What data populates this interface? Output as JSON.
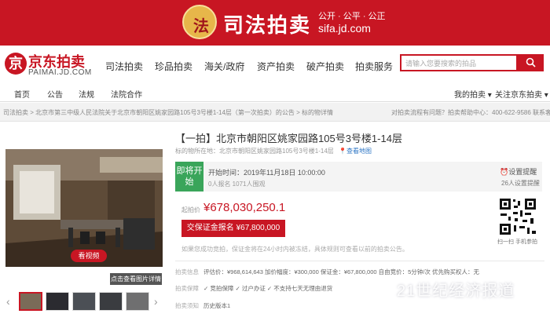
{
  "banner": {
    "emblem_text": "法",
    "title": "司法拍卖",
    "slogan": "公开 · 公平 · 公正",
    "domain": "sifa.jd.com"
  },
  "header": {
    "logo_mark": "京",
    "logo_cn": "京东拍卖",
    "logo_en": "PAIMAI.JD.COM",
    "nav": [
      "司法拍卖",
      "珍品拍卖",
      "海关/政府",
      "资产拍卖",
      "破产拍卖",
      "拍卖服务"
    ],
    "search_placeholder": "请输入您要搜索的拍品"
  },
  "subnav": {
    "items": [
      "首页",
      "公告",
      "法规",
      "法院合作"
    ],
    "right": [
      "我的拍卖 ▾",
      "关注京东拍卖 ▾"
    ]
  },
  "breadcrumb": {
    "path": "司法拍卖 > 北京市第三中级人民法院关于北京市朝阳区姚家园路105号3号楼1-14层（第一次拍卖）的公告 > 标的物详情",
    "right": "对拍卖流程有问题？拍卖帮助中心：400-622-9586  联系客服"
  },
  "gallery": {
    "video_label": "看视频",
    "more_label": "点击查看图片详情",
    "prev": "‹",
    "next": "›"
  },
  "item": {
    "title": "【一拍】北京市朝阳区姚家园路105号3号楼1-14层",
    "address_label": "标的物所在地：",
    "address": "北京市朝阳区姚家园路105号3号楼1-14层",
    "map_link": "查看地图",
    "status": "即将开始",
    "start_time": "开始时间：2019年11月18日 10:00:00",
    "watchers": "0人报名  1071人围观",
    "remind_label": "设置提醒",
    "remind_count": "26人设置提醒",
    "price_label": "起拍价",
    "price": "¥678,030,250.1",
    "deposit_button": "交保证金报名 ¥67,800,000",
    "notice": "如果您成功竞拍，保证金将在24小时内被冻结，具体规则可查看以前的拍卖公告。",
    "qr_caption": "扫一扫 手机参拍"
  },
  "details": {
    "row1_label": "拍卖信息",
    "row1": "评估价：¥968,614,643    加价幅度：¥300,000    保证金：¥67,800,000    自由竞价：5分钟/次    优先购买权人：无",
    "row2_label": "拍卖保障",
    "row2": "✓ 竞拍保障    ✓ 过户办证    ✓ 不支持七天无理由退货",
    "row3_label": "拍卖须知",
    "row3": "历史版本1"
  },
  "watermark": "21世纪经济报道"
}
